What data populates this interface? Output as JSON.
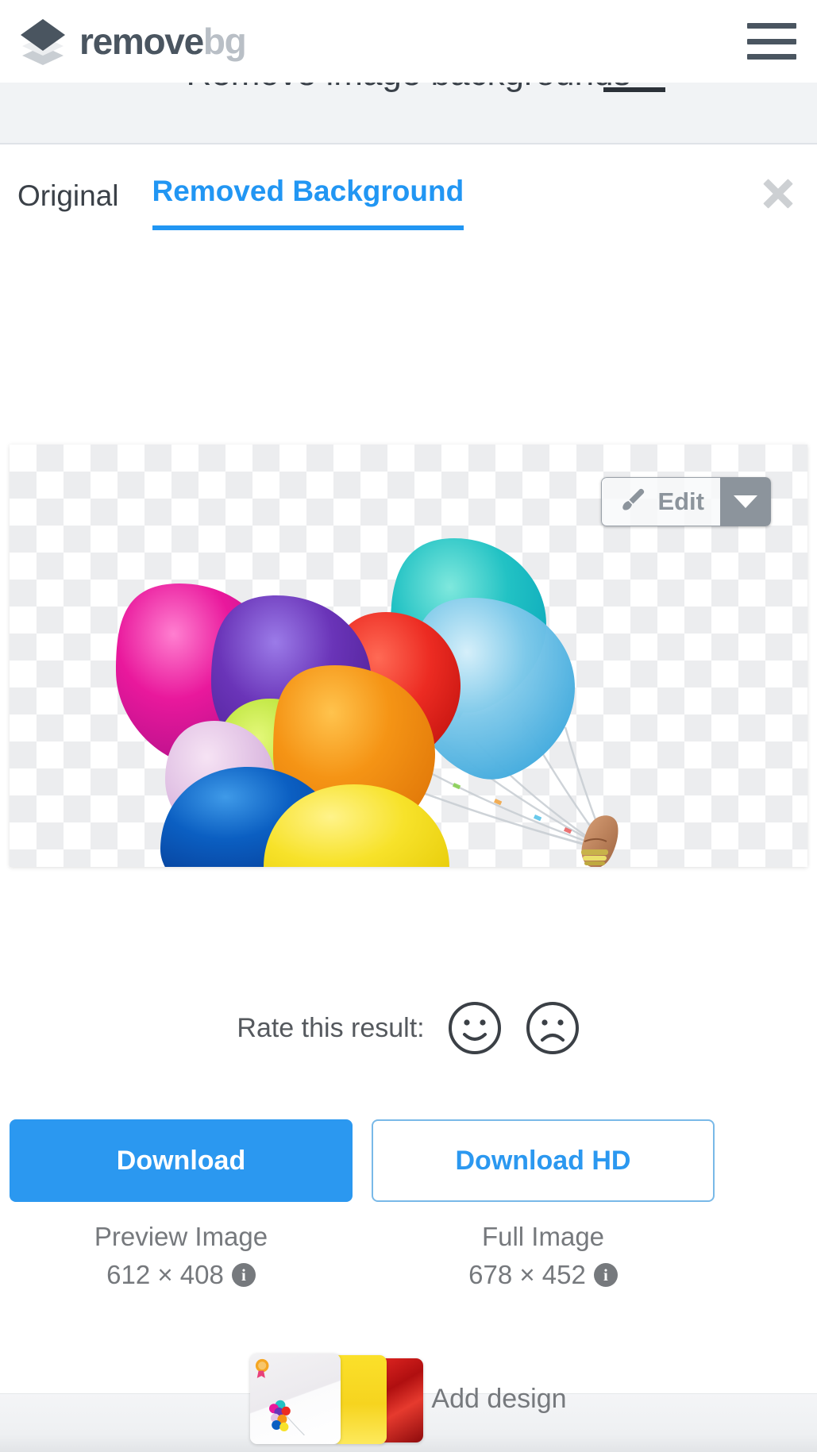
{
  "header": {
    "logo_icon": "layers-diamond-icon",
    "brand_primary": "remove",
    "brand_secondary": "bg",
    "menu_icon": "hamburger-menu-icon"
  },
  "behind_header": {
    "ghost_text": "Remove image backgrounds"
  },
  "result": {
    "tabs": [
      {
        "label": "Original",
        "active": false
      },
      {
        "label": "Removed Background",
        "active": true
      }
    ],
    "close_icon": "close-icon",
    "canvas": {
      "background": "transparent-checkerboard",
      "subject": "bunch-of-colorful-balloons-held-by-hand",
      "edit_button": {
        "label": "Edit",
        "icon": "paintbrush-icon",
        "caret_icon": "chevron-down-icon"
      }
    },
    "rating": {
      "label": "Rate this result:",
      "positive_icon": "smiley-face-icon",
      "negative_icon": "frowny-face-icon"
    },
    "downloads": [
      {
        "button_label": "Download",
        "style": "primary",
        "title": "Preview Image",
        "dimensions": "612 × 408",
        "info_icon": "info-icon"
      },
      {
        "button_label": "Download HD",
        "style": "secondary",
        "title": "Full Image",
        "dimensions": "678 × 452",
        "info_icon": "info-icon"
      }
    ],
    "add_design": {
      "label": "Add design",
      "thumbnails": [
        {
          "name": "balloons-white-card-thumbnail",
          "badge_icon": "award-ribbon-icon"
        },
        {
          "name": "yellow-background-thumbnail"
        },
        {
          "name": "red-satin-background-thumbnail"
        }
      ]
    }
  },
  "colors": {
    "accent_blue": "#2b98f0",
    "brand_dark": "#4a5560",
    "brand_light": "#b9bfc6",
    "muted_text": "#76797d"
  }
}
